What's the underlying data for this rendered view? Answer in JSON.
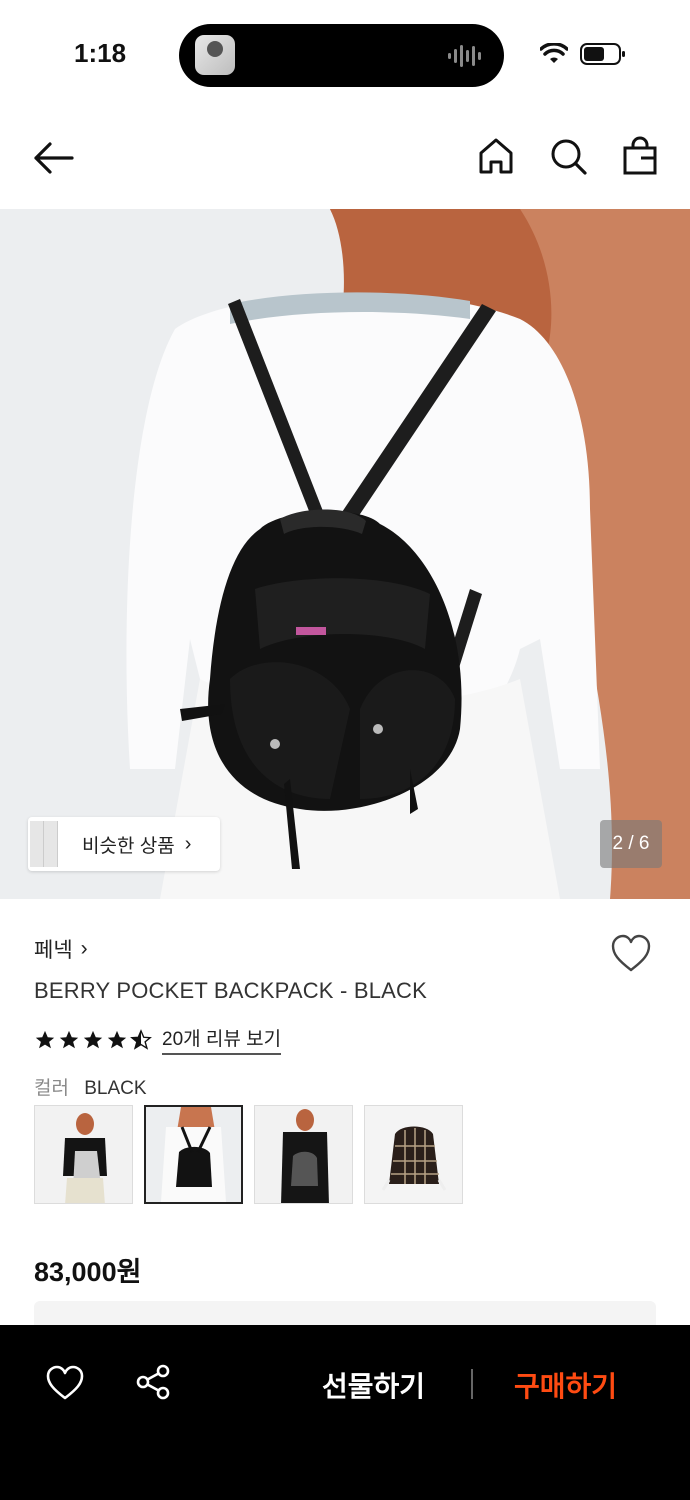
{
  "status_bar": {
    "time": "1:18",
    "icons": [
      "wifi-icon",
      "battery-icon"
    ]
  },
  "nav": {
    "icons": [
      "back-arrow-icon",
      "home-icon",
      "search-icon",
      "shopping-bag-icon"
    ]
  },
  "hero": {
    "similar_label": "비슷한 상품",
    "similar_chevron": "›",
    "page_counter": "2 / 6"
  },
  "product": {
    "brand": "페넥",
    "brand_chevron": "›",
    "name": "BERRY POCKET BACKPACK - BLACK",
    "rating": 4.5,
    "review_link": "20개 리뷰 보기",
    "color_label": "컬러",
    "color_value": "BLACK",
    "swatch_count": 4,
    "selected_swatch": 2,
    "price": "83,000원"
  },
  "bottom_bar": {
    "gift_label": "선물하기",
    "buy_label": "구매하기"
  },
  "colors": {
    "accent": "#ff4b12",
    "bottom_bar": "#000000"
  }
}
